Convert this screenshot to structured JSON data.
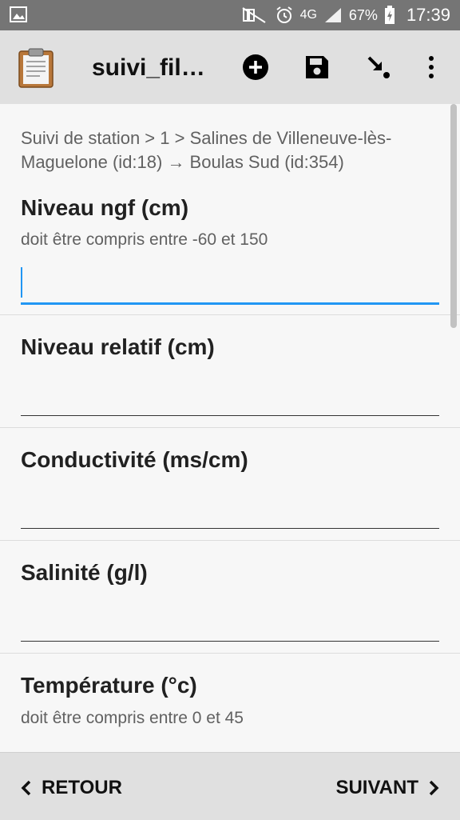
{
  "status_bar": {
    "network": "4G",
    "battery": "67%",
    "time": "17:39",
    "icons": [
      "image-icon",
      "mute-icon",
      "alarm-icon",
      "signal-icon",
      "battery-icon"
    ]
  },
  "app_bar": {
    "title": "suivi_fil…",
    "actions": [
      "add-icon",
      "save-icon",
      "go-to-icon",
      "more-icon"
    ]
  },
  "breadcrumb": "Suivi de station > 1 > Salines de Villeneuve-lès-Maguelone  (id:18) → Boulas Sud (id:354)",
  "fields": [
    {
      "label": "Niveau ngf (cm)",
      "hint": "doit être compris entre -60 et 150",
      "value": ""
    },
    {
      "label": "Niveau relatif (cm)",
      "value": ""
    },
    {
      "label": "Conductivité (ms/cm)",
      "value": ""
    },
    {
      "label": "Salinité (g/l)",
      "value": ""
    },
    {
      "label": "Température (°c)",
      "hint": "doit être compris entre 0 et 45",
      "value": ""
    }
  ],
  "nav": {
    "back": "RETOUR",
    "next": "SUIVANT"
  },
  "colors": {
    "accent": "#2196f3",
    "appbar": "#e0e0e0",
    "statusbar": "#757575"
  }
}
